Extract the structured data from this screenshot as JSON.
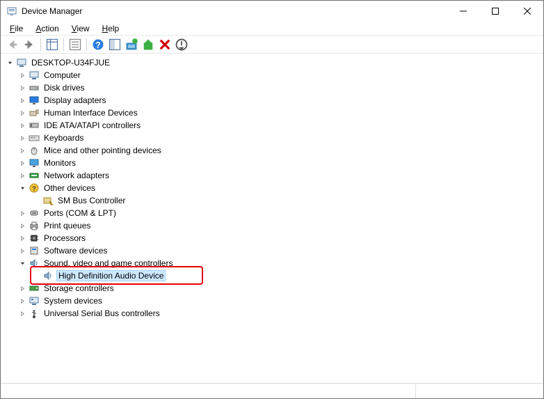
{
  "title": "Device Manager",
  "menu": {
    "file": "File",
    "action": "Action",
    "view": "View",
    "help": "Help"
  },
  "root": "DESKTOP-U34FJUE",
  "nodes": {
    "computer": "Computer",
    "disk": "Disk drives",
    "display": "Display adapters",
    "hid": "Human Interface Devices",
    "ide": "IDE ATA/ATAPI controllers",
    "keyboards": "Keyboards",
    "mice": "Mice and other pointing devices",
    "monitors": "Monitors",
    "network": "Network adapters",
    "other": "Other devices",
    "smbus": "SM Bus Controller",
    "ports": "Ports (COM & LPT)",
    "print": "Print queues",
    "processors": "Processors",
    "software": "Software devices",
    "sound": "Sound, video and game controllers",
    "hdaudio": "High Definition Audio Device",
    "storage": "Storage controllers",
    "system": "System devices",
    "usb": "Universal Serial Bus controllers"
  }
}
